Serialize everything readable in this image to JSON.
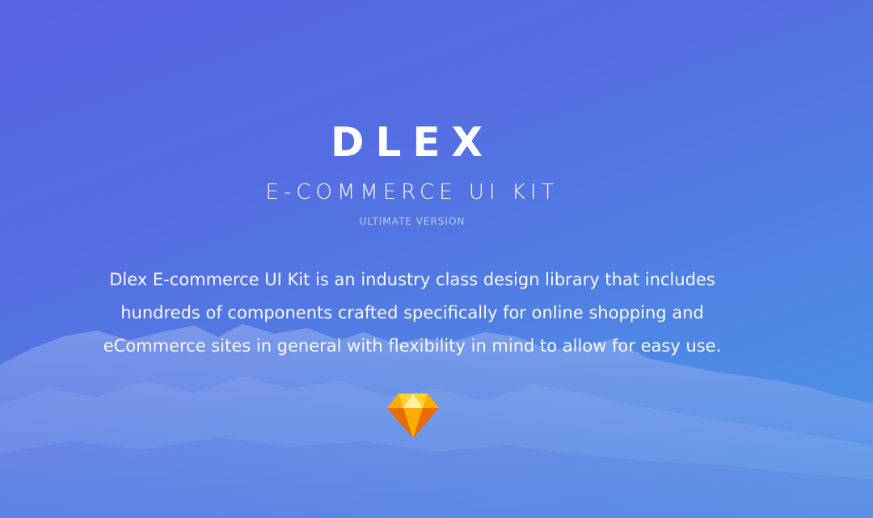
{
  "hero": {
    "brand": "DLEX",
    "subtitle": "E-COMMERCE UI KIT",
    "version": "ULTIMATE VERSION",
    "description": "Dlex E-commerce UI Kit is an industry class design library that includes hundreds of components crafted specifically for online shopping and eCommerce sites in general with flexibility in mind to allow for easy use."
  },
  "icons": {
    "logo": "sketch-diamond-icon"
  },
  "colors": {
    "gradient_start": "#5663e2",
    "gradient_end": "#4a98e6",
    "diamond_light": "#fdd231",
    "diamond_mid": "#fdad00",
    "diamond_dark": "#ea6c00"
  }
}
